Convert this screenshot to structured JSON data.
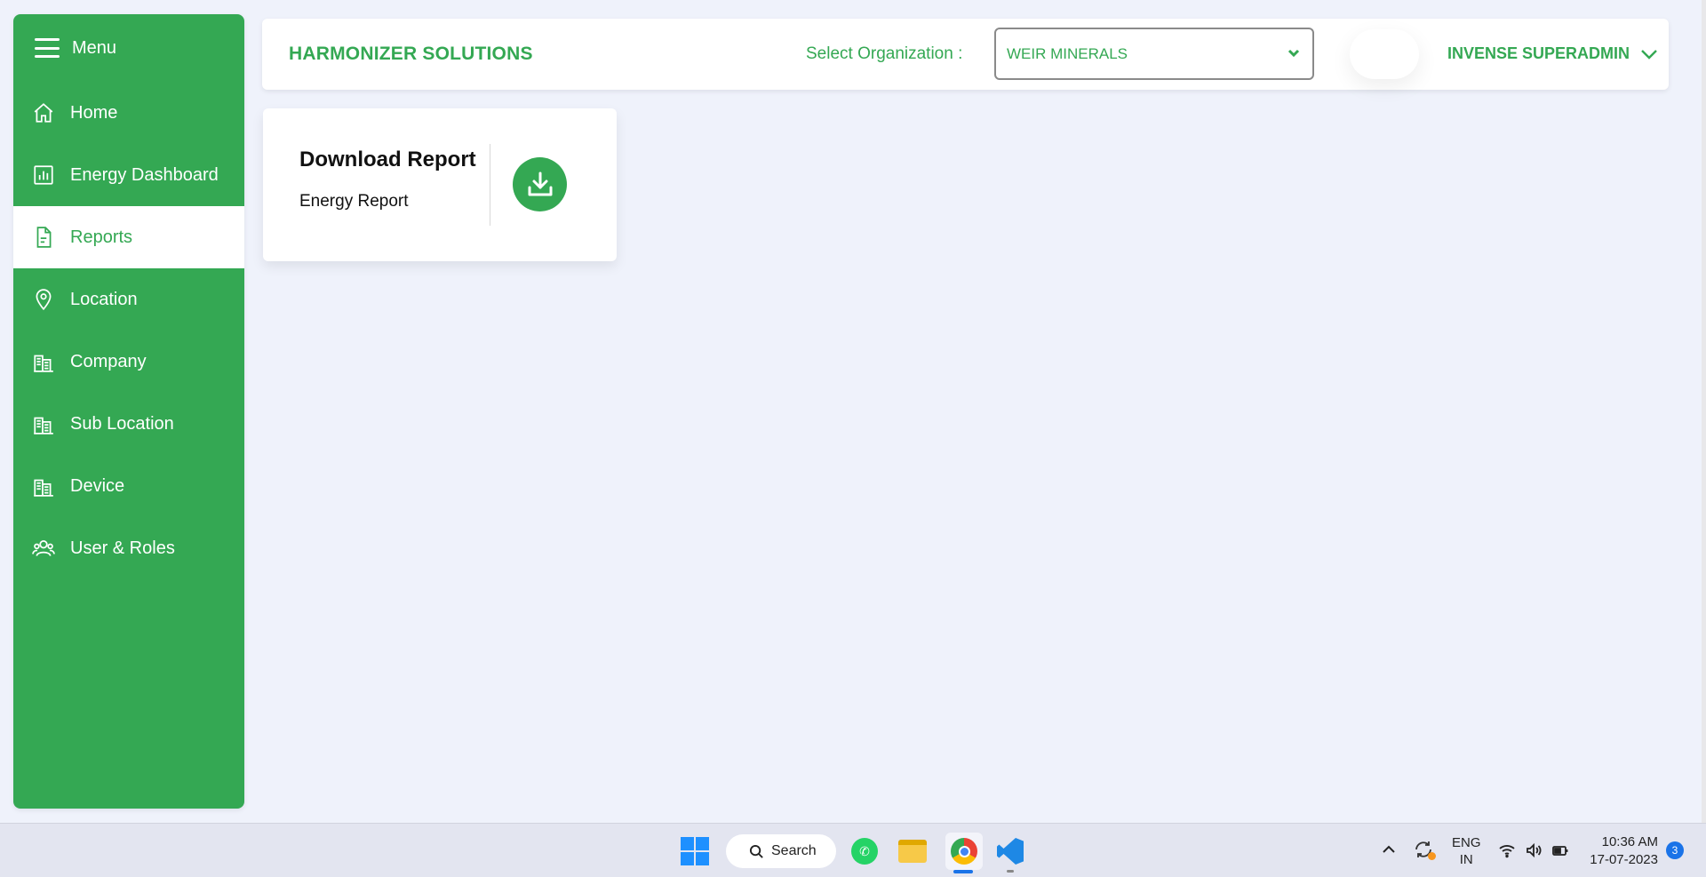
{
  "sidebar": {
    "menu_label": "Menu",
    "items": [
      {
        "label": "Home",
        "icon": "home-icon"
      },
      {
        "label": "Energy Dashboard",
        "icon": "bar-chart-icon"
      },
      {
        "label": "Reports",
        "icon": "document-icon",
        "active": true
      },
      {
        "label": "Location",
        "icon": "map-pin-icon"
      },
      {
        "label": "Company",
        "icon": "buildings-icon"
      },
      {
        "label": "Sub Location",
        "icon": "buildings-icon"
      },
      {
        "label": "Device",
        "icon": "buildings-icon"
      },
      {
        "label": "User & Roles",
        "icon": "users-icon"
      }
    ]
  },
  "header": {
    "brand": "HARMONIZER SOLUTIONS",
    "org_label": "Select Organization :",
    "org_value": "WEIR MINERALS",
    "user_name": "INVENSE SUPERADMIN"
  },
  "report_card": {
    "title": "Download Report",
    "subtitle": "Energy Report"
  },
  "taskbar": {
    "search_label": "Search",
    "lang_line1": "ENG",
    "lang_line2": "IN",
    "time": "10:36 AM",
    "date": "17-07-2023",
    "notification_count": "3"
  },
  "colors": {
    "brand_green": "#34a853",
    "background": "#eff2fb"
  }
}
